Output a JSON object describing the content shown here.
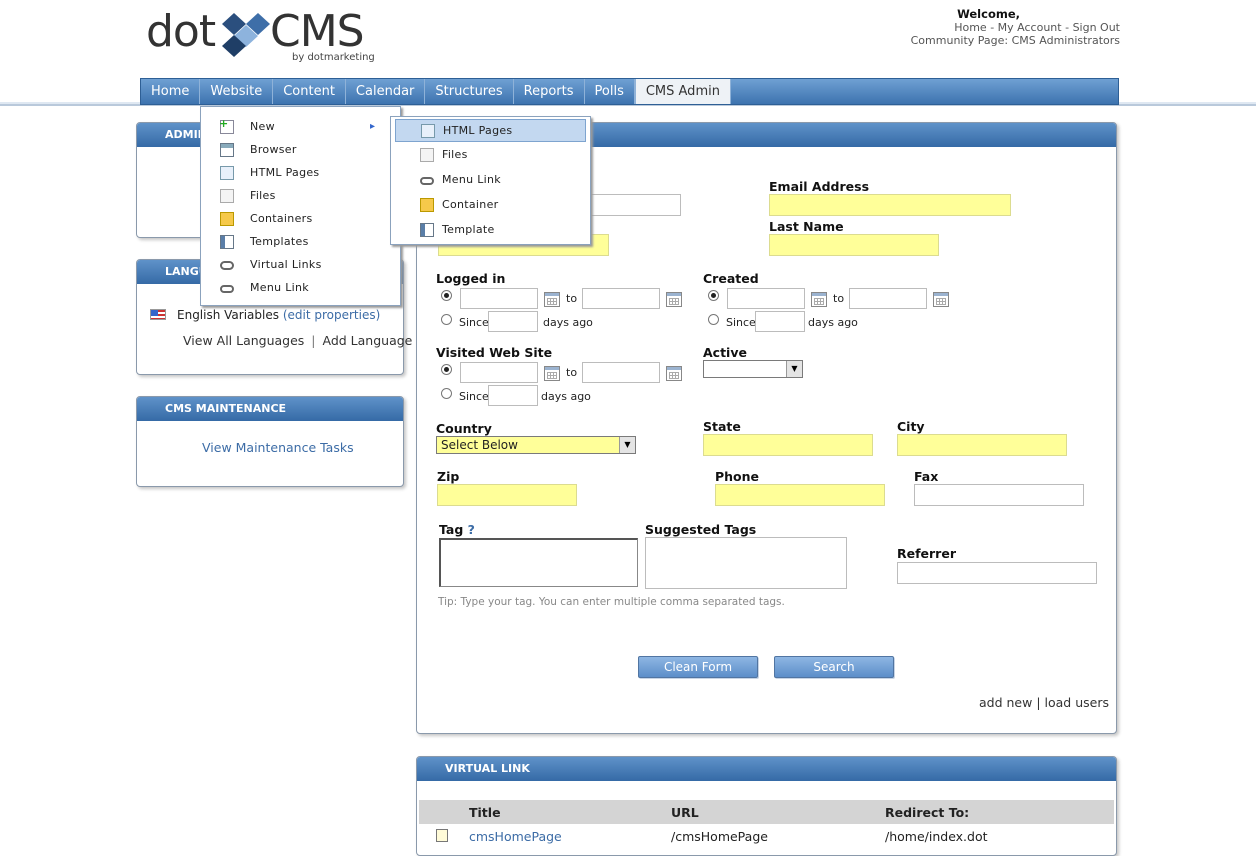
{
  "header": {
    "logo_left": "dot",
    "logo_right": "CMS",
    "logo_by": "by dotmarketing",
    "welcome": "Welcome,",
    "links": {
      "home": "Home",
      "sep1": " - ",
      "account": "My Account",
      "sep2": " - ",
      "signout": "Sign Out"
    },
    "community": "Community Page: CMS Administrators"
  },
  "nav": {
    "tabs": [
      "Home",
      "Website",
      "Content",
      "Calendar",
      "Structures",
      "Reports",
      "Polls",
      "CMS Admin"
    ],
    "active": "CMS Admin"
  },
  "sidebar": {
    "admin_title": "ADMIN",
    "lang_title": "LANGU",
    "lang_row": {
      "name": "English Variables",
      "edit": "(edit properties)"
    },
    "lang_links": {
      "view_all": "View All Languages",
      "sep": "|",
      "add": "Add Language"
    },
    "maint_title": "CMS MAINTENANCE",
    "maint_link": "View Maintenance Tasks"
  },
  "website_menu": {
    "items": [
      "New",
      "Browser",
      "HTML Pages",
      "Files",
      "Containers",
      "Templates",
      "Virtual Links",
      "Menu Link"
    ],
    "submenu_arrow": "▸"
  },
  "new_submenu": {
    "items": [
      "HTML Pages",
      "Files",
      "Menu Link",
      "Container",
      "Template"
    ],
    "highlighted": "HTML Pages"
  },
  "form": {
    "email_label": "Email Address",
    "lastname_label": "Last Name",
    "logged_in_label": "Logged in",
    "created_label": "Created",
    "visited_label": "Visited Web Site",
    "active_label": "Active",
    "to": "to",
    "since": "Since",
    "days_ago": "days ago",
    "country_label": "Country",
    "country_value": "Select Below",
    "state_label": "State",
    "city_label": "City",
    "zip_label": "Zip",
    "phone_label": "Phone",
    "fax_label": "Fax",
    "tag_label": "Tag",
    "tag_help": "?",
    "suggested_label": "Suggested Tags",
    "referrer_label": "Referrer",
    "tip": "Tip: Type your tag. You can enter multiple comma separated tags.",
    "clean_button": "Clean Form",
    "search_button": "Search",
    "add_new": "add new",
    "sep": "|",
    "load_users": "load users"
  },
  "virtual_link": {
    "title": "VIRTUAL LINK",
    "columns": [
      "Title",
      "URL",
      "Redirect To:"
    ],
    "rows": [
      {
        "title": "cmsHomePage",
        "url": "/cmsHomePage",
        "redirect": "/home/index.dot"
      }
    ]
  },
  "colors": {
    "nav": "#4a80bd",
    "highlight": "#ffff99",
    "link": "#3c6ca6"
  }
}
